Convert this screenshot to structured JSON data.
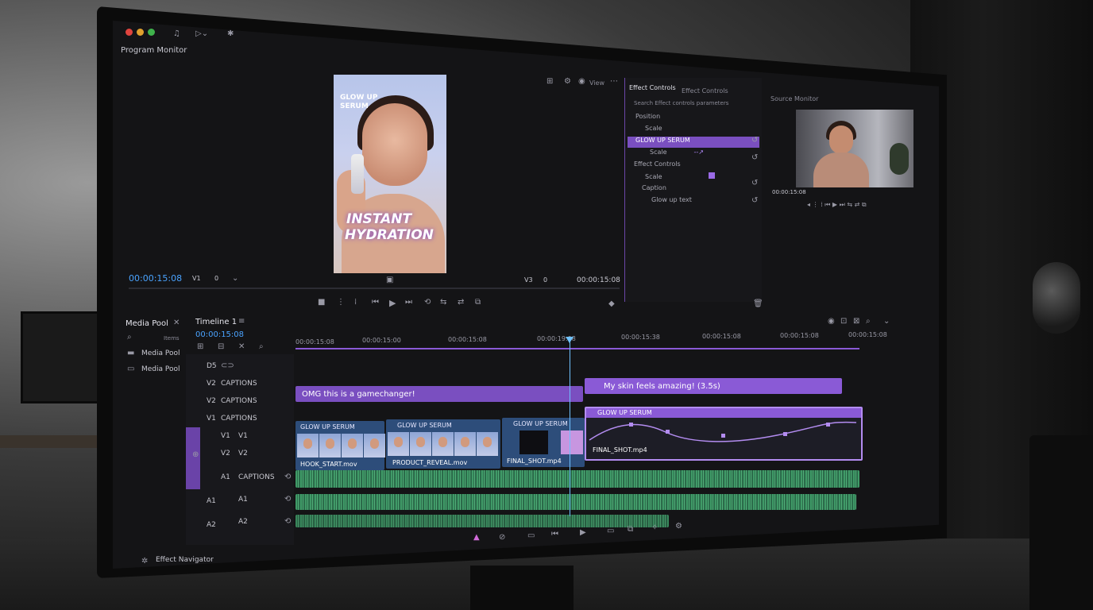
{
  "program_monitor": {
    "title": "Program Monitor",
    "timecode_left": "00:00:15:08",
    "track_select": "V1",
    "track_value": "0",
    "timecode_right": "00:00:15:08",
    "right_track": "V3",
    "right_value": "0",
    "view_label": "View"
  },
  "preview": {
    "small_text": "GLOW UP SERUM",
    "line1": "INSTANT",
    "line2": "HYDRATION"
  },
  "effect_controls": {
    "tab1": "Effect Controls",
    "tab2": "Effect Controls",
    "search": "Search Effect controls parameters",
    "rows": [
      "Position",
      "Scale",
      "GLOW UP SERUM",
      "Scale",
      "Effect Controls",
      "Scale",
      "Caption",
      "Glow up text"
    ]
  },
  "source_monitor": {
    "title": "Source Monitor",
    "timecode": "00:00:15:08"
  },
  "media_pool": {
    "title": "Media Pool",
    "items": [
      "Media Pool",
      "Media Pool"
    ],
    "count_label": "Items"
  },
  "timeline": {
    "title": "Timeline 1",
    "timecode": "00:00:15:08",
    "ruler": [
      "00:00:15:08",
      "00:00:15:00",
      "00:00:15:08",
      "00:00:19:08",
      "00:00:15:38",
      "00:00:15:08",
      "00:00:15:08",
      "00:00:15:08"
    ],
    "tracks": [
      {
        "id": "D5",
        "name": ""
      },
      {
        "id": "V2",
        "name": "CAPTIONS"
      },
      {
        "id": "V2",
        "name": "CAPTIONS"
      },
      {
        "id": "V1",
        "name": "CAPTIONS"
      },
      {
        "id": "V1",
        "name": "V1"
      },
      {
        "id": "V2",
        "name": "V2"
      },
      {
        "id": "A1",
        "name": "CAPTIONS"
      },
      {
        "id": "A1",
        "name": "A1"
      },
      {
        "id": "A2",
        "name": "A2"
      }
    ],
    "captions": [
      "OMG this is a gamechanger!",
      "My skin feels amazing! (3.5s)"
    ],
    "clip_titles": [
      "GLOW UP SERUM",
      "GLOW UP SERUM",
      "GLOW UP SERUM",
      "GLOW UP SERUM"
    ],
    "clip_files": [
      "HOOK_START.mov",
      "PRODUCT_REVEAL.mov",
      "FINAL_SHOT.mp4",
      "FINAL_SHOT.mp4"
    ]
  },
  "footer": {
    "effects_navigator": "Effect Navigator"
  },
  "colors": {
    "accent": "#8a5ad6",
    "timecode": "#4aa3ff",
    "audio": "#3f9a67"
  }
}
